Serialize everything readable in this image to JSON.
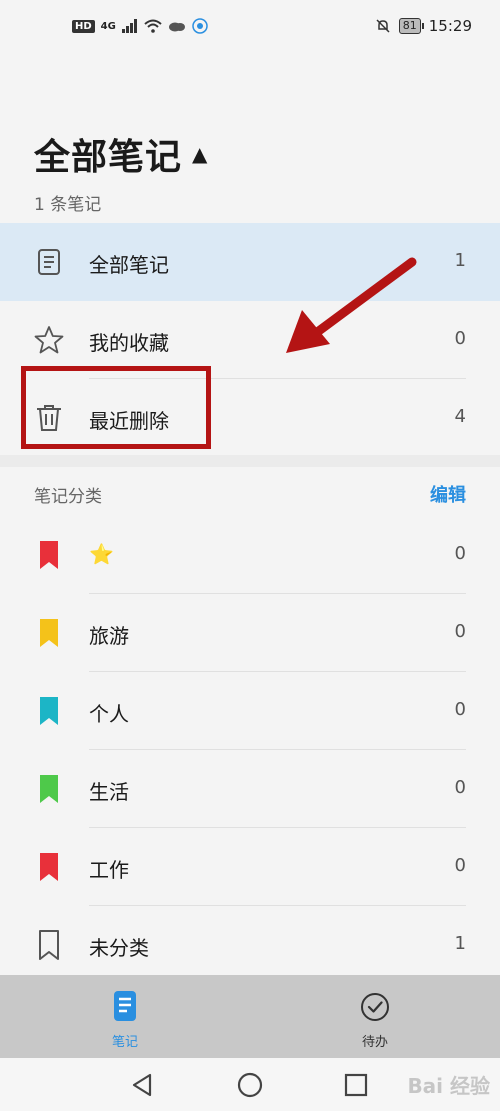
{
  "status": {
    "hd": "HD",
    "signal": "4G",
    "battery": "81",
    "time": "15:29"
  },
  "header": {
    "title": "全部笔记",
    "subtitle": "1 条笔记"
  },
  "nav_list": [
    {
      "label": "全部笔记",
      "count": "1",
      "icon": "note-icon",
      "selected": true
    },
    {
      "label": "我的收藏",
      "count": "0",
      "icon": "star-outline-icon"
    },
    {
      "label": "最近删除",
      "count": "4",
      "icon": "trash-icon"
    }
  ],
  "categories": {
    "title": "笔记分类",
    "edit_label": "编辑",
    "items": [
      {
        "label": "⭐",
        "count": "0",
        "color": "#e8303a"
      },
      {
        "label": "旅游",
        "count": "0",
        "color": "#f4c21a"
      },
      {
        "label": "个人",
        "count": "0",
        "color": "#1cb5c6"
      },
      {
        "label": "生活",
        "count": "0",
        "color": "#4ec94a"
      },
      {
        "label": "工作",
        "count": "0",
        "color": "#e8303a"
      },
      {
        "label": "未分类",
        "count": "1",
        "color": "outline"
      }
    ]
  },
  "tabbar": {
    "notes_label": "笔记",
    "todo_label": "待办",
    "accent": "#2a8fe0"
  },
  "watermark": "Bai 经验"
}
